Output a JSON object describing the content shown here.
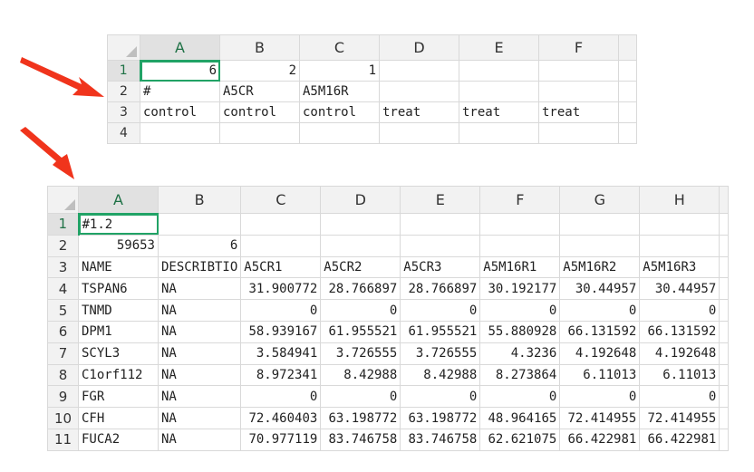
{
  "top_sheet": {
    "columns": [
      "A",
      "B",
      "C",
      "D",
      "E",
      "F"
    ],
    "active_column": "A",
    "active_row": "1",
    "rows": [
      {
        "num": "1",
        "cells": [
          "6",
          "2",
          "1",
          "",
          "",
          ""
        ]
      },
      {
        "num": "2",
        "cells": [
          "#",
          "A5CR",
          "A5M16R",
          "",
          "",
          ""
        ]
      },
      {
        "num": "3",
        "cells": [
          "control",
          "control",
          "control",
          "treat",
          "treat",
          "treat"
        ]
      },
      {
        "num": "4",
        "cells": [
          "",
          "",
          "",
          "",
          "",
          ""
        ]
      }
    ]
  },
  "bottom_sheet": {
    "columns": [
      "A",
      "B",
      "C",
      "D",
      "E",
      "F",
      "G",
      "H"
    ],
    "active_column": "A",
    "active_row": "1",
    "rows": [
      {
        "num": "1",
        "cells": [
          "#1.2",
          "",
          "",
          "",
          "",
          "",
          "",
          ""
        ]
      },
      {
        "num": "2",
        "cells": [
          "59653",
          "6",
          "",
          "",
          "",
          "",
          "",
          ""
        ]
      },
      {
        "num": "3",
        "cells": [
          "NAME",
          "DESCRIBTIO",
          "A5CR1",
          "A5CR2",
          "A5CR3",
          "A5M16R1",
          "A5M16R2",
          "A5M16R3"
        ]
      },
      {
        "num": "4",
        "cells": [
          "TSPAN6",
          "NA",
          "31.900772",
          "28.766897",
          "28.766897",
          "30.192177",
          "30.44957",
          "30.44957"
        ]
      },
      {
        "num": "5",
        "cells": [
          "TNMD",
          "NA",
          "0",
          "0",
          "0",
          "0",
          "0",
          "0"
        ]
      },
      {
        "num": "6",
        "cells": [
          "DPM1",
          "NA",
          "58.939167",
          "61.955521",
          "61.955521",
          "55.880928",
          "66.131592",
          "66.131592"
        ]
      },
      {
        "num": "7",
        "cells": [
          "SCYL3",
          "NA",
          "3.584941",
          "3.726555",
          "3.726555",
          "4.3236",
          "4.192648",
          "4.192648"
        ]
      },
      {
        "num": "8",
        "cells": [
          "C1orf112",
          "NA",
          "8.972341",
          "8.42988",
          "8.42988",
          "8.273864",
          "6.11013",
          "6.11013"
        ]
      },
      {
        "num": "9",
        "cells": [
          "FGR",
          "NA",
          "0",
          "0",
          "0",
          "0",
          "0",
          "0"
        ]
      },
      {
        "num": "10",
        "cells": [
          "CFH",
          "NA",
          "72.460403",
          "63.198772",
          "63.198772",
          "48.964165",
          "72.414955",
          "72.414955"
        ]
      },
      {
        "num": "11",
        "cells": [
          "FUCA2",
          "NA",
          "70.977119",
          "83.746758",
          "83.746758",
          "62.621075",
          "66.422981",
          "66.422981"
        ]
      }
    ]
  },
  "colors": {
    "accent": "#21a366",
    "arrow": "#f0341c",
    "grid": "#d9d9d9",
    "header_bg": "#f2f2f2"
  }
}
